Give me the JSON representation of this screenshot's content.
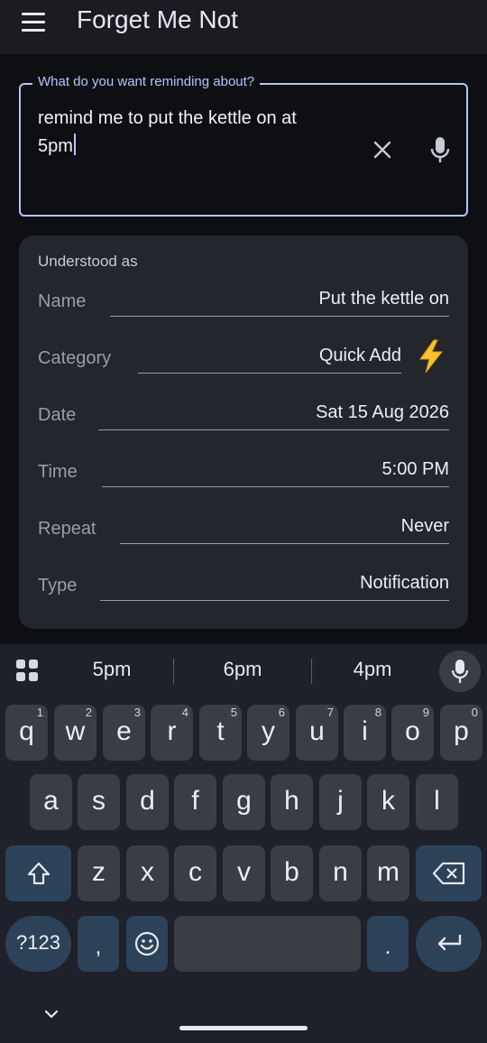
{
  "app": {
    "title": "Forget Me Not",
    "menu_icon": "hamburger-menu-icon"
  },
  "input": {
    "label": "What do you want reminding about?",
    "value": "remind me to put the kettle on at\n5pm",
    "accent": "#b4c5ff"
  },
  "parsed": {
    "heading": "Understood as",
    "rows": [
      {
        "label": "Name",
        "value": "Put the kettle on"
      },
      {
        "label": "Category",
        "value": "Quick Add",
        "icon": "lightning-bolt-icon"
      },
      {
        "label": "Date",
        "value": "Sat 15 Aug 2026"
      },
      {
        "label": "Time",
        "value": "5:00 PM"
      },
      {
        "label": "Repeat",
        "value": "Never"
      },
      {
        "label": "Type",
        "value": "Notification"
      }
    ]
  },
  "keyboard": {
    "suggestions": [
      "5pm",
      "6pm",
      "4pm"
    ],
    "row1": [
      {
        "key": "q",
        "hint": "1"
      },
      {
        "key": "w",
        "hint": "2"
      },
      {
        "key": "e",
        "hint": "3"
      },
      {
        "key": "r",
        "hint": "4"
      },
      {
        "key": "t",
        "hint": "5"
      },
      {
        "key": "y",
        "hint": "6"
      },
      {
        "key": "u",
        "hint": "7"
      },
      {
        "key": "i",
        "hint": "8"
      },
      {
        "key": "o",
        "hint": "9"
      },
      {
        "key": "p",
        "hint": "0"
      }
    ],
    "row2": [
      "a",
      "s",
      "d",
      "f",
      "g",
      "h",
      "j",
      "k",
      "l"
    ],
    "row3": [
      "z",
      "x",
      "c",
      "v",
      "b",
      "n",
      "m"
    ],
    "symbols_label": "?123",
    "comma": ",",
    "period": "."
  }
}
